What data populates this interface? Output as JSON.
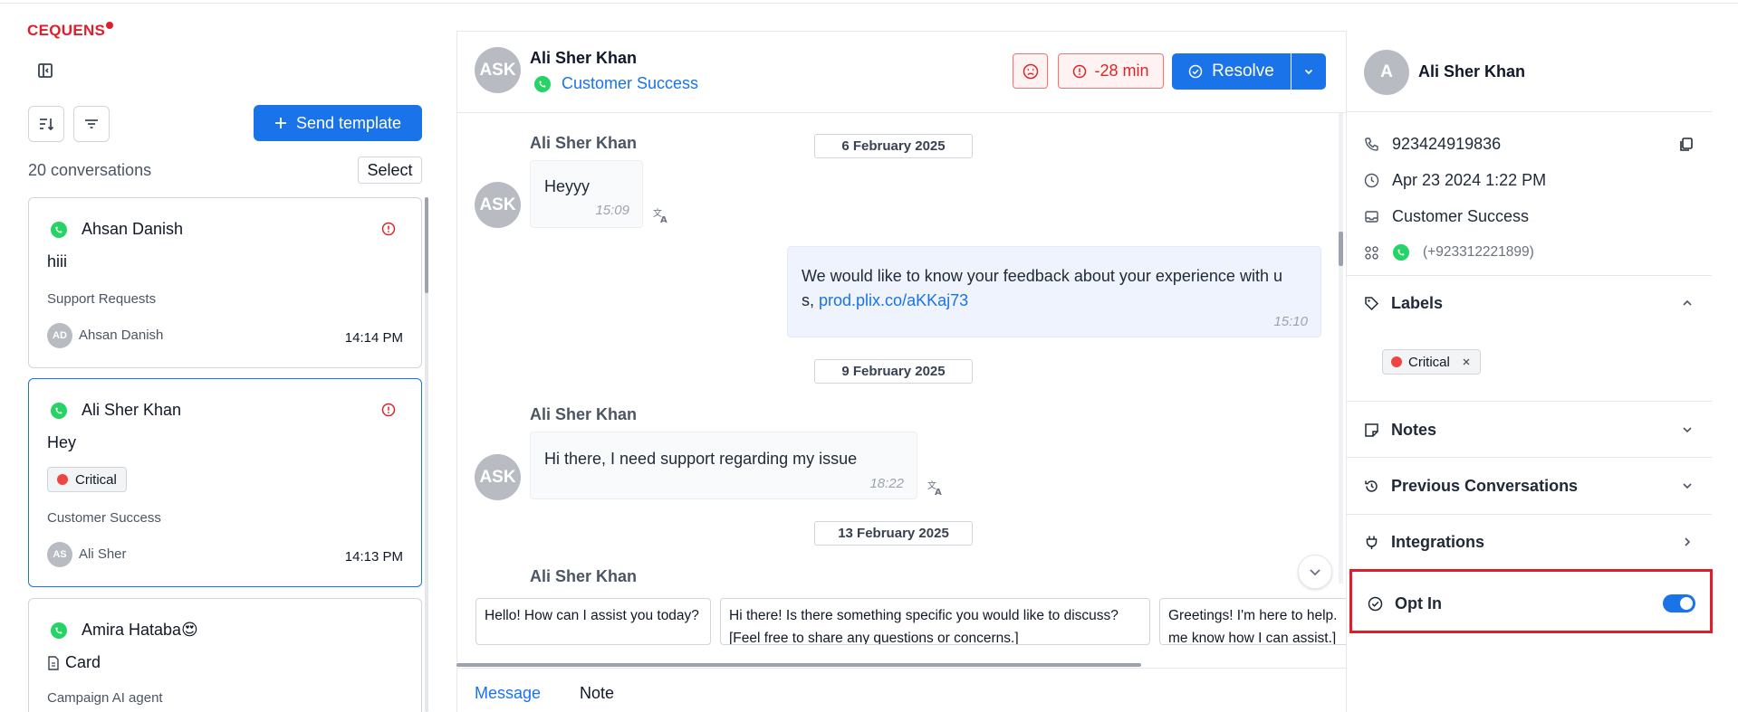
{
  "brand": {
    "logo_text": "CEQUENS"
  },
  "sidebar": {
    "send_template_label": "Send template",
    "conversation_count": "20 conversations",
    "select_label": "Select",
    "conversations": [
      {
        "name": "Ahsan Danish",
        "message": "hiii",
        "inbox": "Support Requests",
        "agent_initials": "AD",
        "agent": "Ahsan Danish",
        "time": "14:14 PM"
      },
      {
        "name": "Ali Sher Khan",
        "message": "Hey",
        "label": "Critical",
        "inbox": "Customer Success",
        "agent_initials": "AS",
        "agent": "Ali Sher",
        "time": "14:13 PM"
      },
      {
        "name": "Amira Hataba😍",
        "message": "Card",
        "inbox": "Campaign AI agent"
      }
    ]
  },
  "chat": {
    "contact_initials": "ASK",
    "contact_name": "Ali Sher Khan",
    "inbox": "Customer Success",
    "sla": "-28 min",
    "resolve_label": "Resolve",
    "dates": [
      "6 February 2025",
      "9 February 2025",
      "13 February 2025"
    ],
    "messages": [
      {
        "sender": "Ali Sher Khan",
        "text": "Heyyy",
        "time": "15:09"
      },
      {
        "text_line1": "We would like to know your feedback about your experience with u",
        "text_line2_prefix": "s, ",
        "link": "prod.plix.co/aKKaj73",
        "time": "15:10"
      },
      {
        "sender": "Ali Sher Khan",
        "text": "Hi there, I need support regarding my issue",
        "time": "18:22"
      },
      {
        "sender": "Ali Sher Khan"
      }
    ],
    "suggestions": [
      {
        "line1": "Hello! How can I assist you today?"
      },
      {
        "line1": "Hi there! Is there something specific you would like to discuss?",
        "line2": "[Feel free to share any questions or concerns.]"
      },
      {
        "line1": "Greetings! I'm here to help.",
        "line2": "me know how I can assist.]"
      }
    ],
    "tabs": {
      "message": "Message",
      "note": "Note"
    }
  },
  "contact": {
    "initial": "A",
    "name": "Ali Sher Khan",
    "phone": "923424919836",
    "created": "Apr 23 2024 1:22 PM",
    "inbox": "Customer Success",
    "channel_number": "(+923312221899)",
    "sections": {
      "labels": "Labels",
      "label_value": "Critical",
      "notes": "Notes",
      "previous": "Previous Conversations",
      "integrations": "Integrations",
      "opt_in": "Opt In"
    },
    "opt_in_enabled": true
  },
  "colors": {
    "primary": "#1a73e8",
    "danger": "#e11d2b",
    "whatsapp": "#25d366"
  }
}
